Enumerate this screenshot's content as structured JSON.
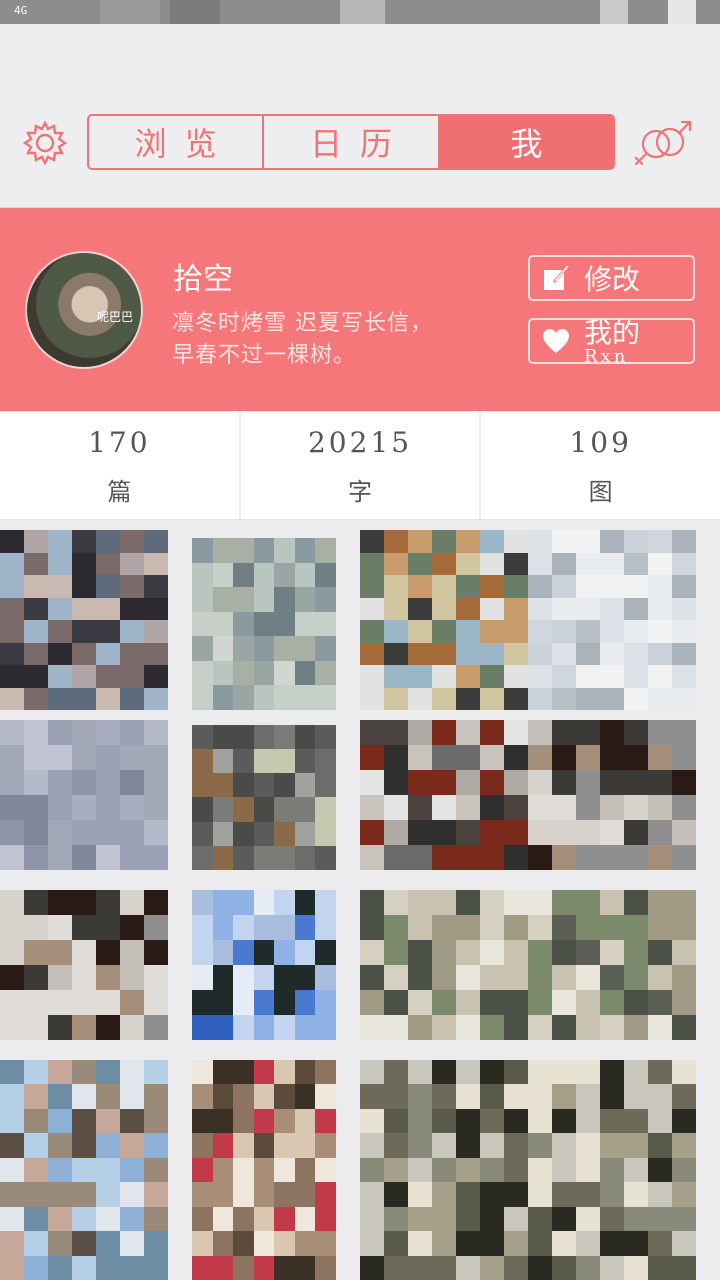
{
  "status_bar": {
    "signal": "4G"
  },
  "header": {
    "settings_icon": "gear-icon",
    "tabs": [
      {
        "label": "浏览",
        "active": false
      },
      {
        "label": "日历",
        "active": false
      },
      {
        "label": "我",
        "active": true
      }
    ],
    "gender_icon": "gender-icon"
  },
  "profile": {
    "avatar_watermark": "呢巴巴",
    "name": "拾空",
    "bio_line1": "凛冬时烤雪 迟夏写长信，",
    "bio_line2": "早春不过一棵树。",
    "edit_label": "修改",
    "fav_label": "我的",
    "fav_label_partial": "Rxn"
  },
  "stats": [
    {
      "value": "170",
      "label": "篇"
    },
    {
      "value": "20215",
      "label": "字"
    },
    {
      "value": "109",
      "label": "图"
    }
  ],
  "colors": {
    "accent": "#f06f73",
    "profile_bg": "#f6777a",
    "page_bg": "#ecebee"
  }
}
